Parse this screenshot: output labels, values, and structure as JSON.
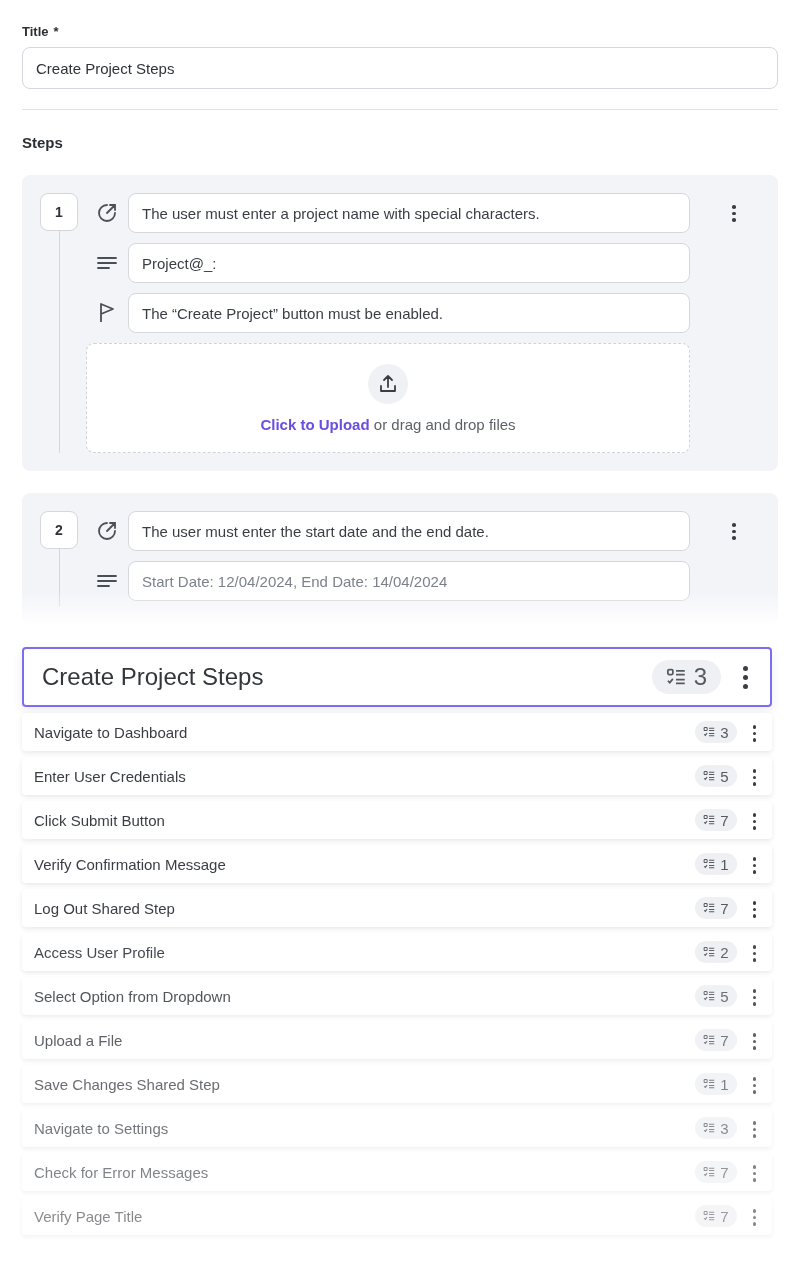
{
  "title_field": {
    "label": "Title",
    "required_mark": "*",
    "value": "Create Project Steps"
  },
  "steps_heading": "Steps",
  "steps": [
    {
      "number": "1",
      "faded": false,
      "action": "The user must enter a project name with special characters.",
      "data": "Project@_:",
      "expected": "The “Create Project” button must be enabled.",
      "upload": {
        "link": "Click to Upload",
        "text": "or drag and drop files"
      }
    },
    {
      "number": "2",
      "faded": true,
      "action": "The user must enter the start date and the end date.",
      "placeholder": "Start Date: 12/04/2024, End Date: 14/04/2024"
    }
  ],
  "dragged_item": {
    "title": "Create Project Steps",
    "count": "3"
  },
  "shared_steps": [
    {
      "title": "Navigate to Dashboard",
      "count": "3"
    },
    {
      "title": "Enter User Credentials",
      "count": "5"
    },
    {
      "title": "Click Submit Button",
      "count": "7"
    },
    {
      "title": "Verify Confirmation Message",
      "count": "1"
    },
    {
      "title": "Log Out Shared Step",
      "count": "7"
    },
    {
      "title": "Access User Profile",
      "count": "2"
    },
    {
      "title": "Select Option from Dropdown",
      "count": "5"
    },
    {
      "title": "Upload a File",
      "count": "7"
    },
    {
      "title": "Save Changes Shared Step",
      "count": "1"
    },
    {
      "title": "Navigate to Settings",
      "count": "3"
    },
    {
      "title": "Check for Error Messages",
      "count": "7"
    },
    {
      "title": "Verify Page Title",
      "count": "7"
    }
  ]
}
